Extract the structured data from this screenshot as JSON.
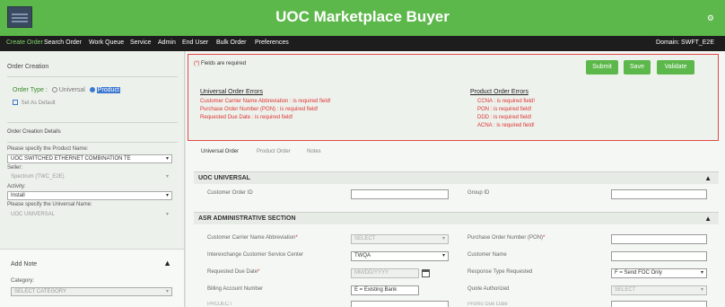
{
  "app": {
    "title": "UOC Marketplace Buyer"
  },
  "nav": {
    "items": [
      "Create Order",
      "Search Order",
      "Work Queue",
      "Service",
      "Admin",
      "End User",
      "Bulk Order",
      "Preferences"
    ],
    "domain": "Domain: SWFT_E2E"
  },
  "sidebar": {
    "order_creation": "Order Creation",
    "order_type_label": "Order Type :",
    "order_type_universal": "Universal",
    "order_type_product": "Product",
    "set_default": "Set As Default",
    "order_creation_details": "Order Creation Details",
    "product_name_label": "Please specify the Product Name:",
    "product_name_value": "UOC SWITCHED ETHERNET COMBINATION TE",
    "seller_label": "Seller:",
    "seller_value": "Spectrum (TWC_E2E)",
    "activity_label": "Activity:",
    "activity_value": "Install",
    "universal_name_label": "Please specify the Universal Name:",
    "universal_name_value": "UOC UNIVERSAL",
    "add_note": "Add Note",
    "category_label": "Category:",
    "category_placeholder": "SELECT CATEGORY"
  },
  "errors": {
    "required_marker": "(*)",
    "required_text": "Fields are required",
    "buttons": {
      "submit": "Submit",
      "save": "Save",
      "validate": "Validate"
    },
    "universal_title": "Universal Order Errors",
    "universal": [
      "Customer Carrier Name Abbreviation : is required field!",
      "Purchase Order Number (PON) : is required field!",
      "Requested Due Date : is required field!"
    ],
    "product_title": "Product Order Errors",
    "product": [
      "CCNA : is required field!",
      "PON : is required field!",
      "DDD : is required field!",
      "ACNA : is required field!"
    ]
  },
  "tabs": [
    "Universal Order",
    "Product Order",
    "Notes"
  ],
  "uoc_universal": {
    "title": "UOC UNIVERSAL",
    "customer_order_id": "Customer Order ID",
    "group_id": "Group ID"
  },
  "asr": {
    "title": "ASR ADMINISTRATIVE SECTION",
    "ccna_label": "Customer Carrier Name Abbreviation",
    "ccna_value": "SELECT",
    "pon_label": "Purchase Order Number (PON)",
    "iccsc_label": "Interexchange Customer Service Center",
    "iccsc_value": "TWQA",
    "customer_name_label": "Customer Name",
    "due_date_label": "Requested Due Date",
    "due_date_placeholder": "MM/DD/YYYY",
    "response_type_label": "Response Type Requested",
    "response_type_value": "F = Send FOC Only",
    "ban_label": "Billing Account Number",
    "ban_value": "E = Existing Bank",
    "quote_label": "Quote Authorized",
    "quote_value": "SELECT",
    "project_label": "PROJECT",
    "promo_label": "Promo Due Date"
  }
}
